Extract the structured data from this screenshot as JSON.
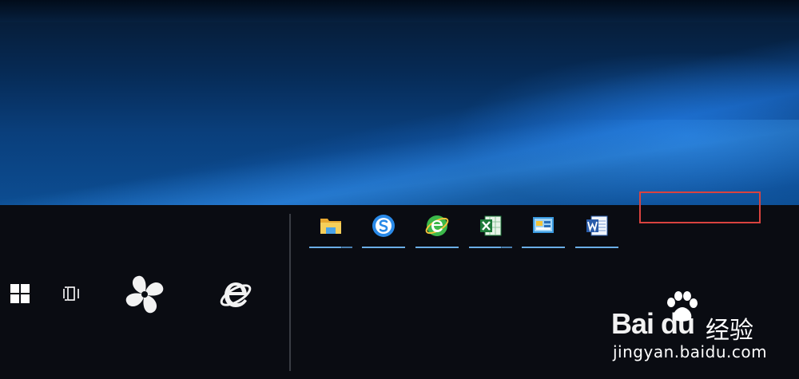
{
  "desktop": {
    "wallpaper": "windows-10-hero-blue"
  },
  "taskbar": {
    "start_icon": "windows-logo-icon",
    "task_view_icon": "task-view-icon",
    "pinned": [
      {
        "name": "fan-app-icon"
      },
      {
        "name": "internet-explorer-icon"
      }
    ],
    "apps": [
      {
        "name": "file-explorer-icon",
        "accent": "#f3c43b"
      },
      {
        "name": "sogou-browser-icon",
        "accent": "#2a8ae8"
      },
      {
        "name": "360-browser-icon",
        "accent": "#3cb84a"
      },
      {
        "name": "excel-icon",
        "accent": "#1f7a3a"
      },
      {
        "name": "control-panel-icon",
        "accent": "#3a9ae0"
      },
      {
        "name": "word-icon",
        "accent": "#2a5caa"
      }
    ],
    "running_underline_color": "#6aaee6"
  },
  "annotation": {
    "highlight_color": "#d9433f"
  },
  "watermark": {
    "brand": "Bai du",
    "chinese": "经验",
    "url": "jingyan.baidu.com"
  }
}
